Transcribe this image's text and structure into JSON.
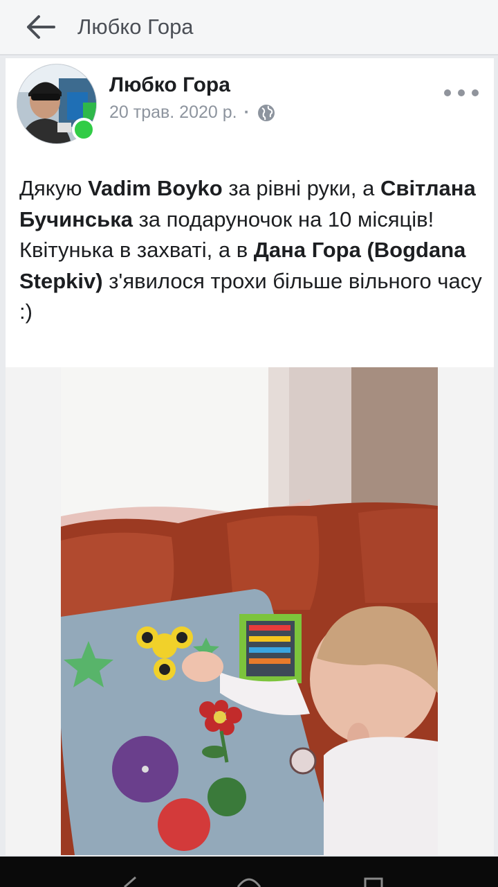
{
  "topbar": {
    "back_icon": "arrow-left-icon",
    "title": "Любко Гора"
  },
  "post": {
    "author": "Любко Гора",
    "date": "20 трав. 2020 р.",
    "meta_separator": "·",
    "privacy_icon": "globe-icon",
    "more_icon": "more-horizontal-icon",
    "online_color": "#31cc46",
    "text": {
      "t1": "Дякую ",
      "mention1": "Vadim Boyko",
      "t2": " за рівні руки, а ",
      "mention2": "Світлана Бучинська",
      "t3": " за подаруночок на 10 місяців! Квітунька в захваті, а в ",
      "mention3": "Дана Гора (Bogdana Stepkiv)",
      "t4": " з'явилося трохи більше вільного часу :)"
    },
    "photo_icon": "baby-busy-board-photo"
  },
  "system_nav": {
    "icons": [
      "back-triangle-icon",
      "home-circle-icon",
      "recents-square-icon"
    ]
  }
}
